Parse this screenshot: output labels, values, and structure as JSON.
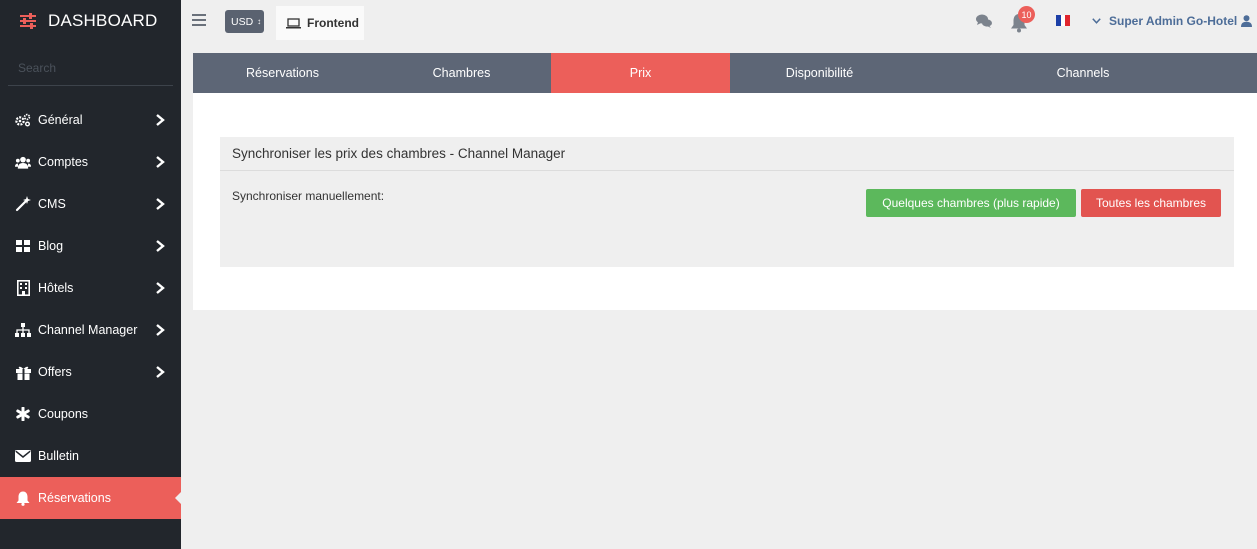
{
  "sidebar": {
    "brand": "DASHBOARD",
    "search_placeholder": "Search",
    "items": [
      {
        "label": "Général",
        "icon": "cogs-icon"
      },
      {
        "label": "Comptes",
        "icon": "users-icon"
      },
      {
        "label": "CMS",
        "icon": "magic-wand-icon"
      },
      {
        "label": "Blog",
        "icon": "grid-icon"
      },
      {
        "label": "Hôtels",
        "icon": "building-icon"
      },
      {
        "label": "Channel Manager",
        "icon": "sitemap-icon"
      },
      {
        "label": "Offers",
        "icon": "gift-icon"
      },
      {
        "label": "Coupons",
        "icon": "asterisk-icon"
      },
      {
        "label": "Bulletin",
        "icon": "envelope-icon"
      },
      {
        "label": "Réservations",
        "icon": "bell-icon"
      }
    ],
    "active_item": "Réservations"
  },
  "topbar": {
    "currency": "USD",
    "frontend_label": "Frontend",
    "notification_count": "10",
    "user_name": "Super Admin Go-Hotel"
  },
  "tabs": [
    {
      "label": "Réservations"
    },
    {
      "label": "Chambres"
    },
    {
      "label": "Prix"
    },
    {
      "label": "Disponibilité"
    },
    {
      "label": "Channels"
    }
  ],
  "active_tab": "Prix",
  "panel": {
    "title": "Synchroniser les prix des chambres - Channel Manager",
    "sync_label": "Synchroniser manuellement:",
    "btn_some": "Quelques chambres (plus rapide)",
    "btn_all": "Toutes les chambres"
  },
  "colors": {
    "accent": "#ec5f5a",
    "sidebar_bg": "#22262c",
    "tabs_bg": "#5d6676",
    "green": "#5cb85c",
    "user_text": "#4d6d98"
  }
}
